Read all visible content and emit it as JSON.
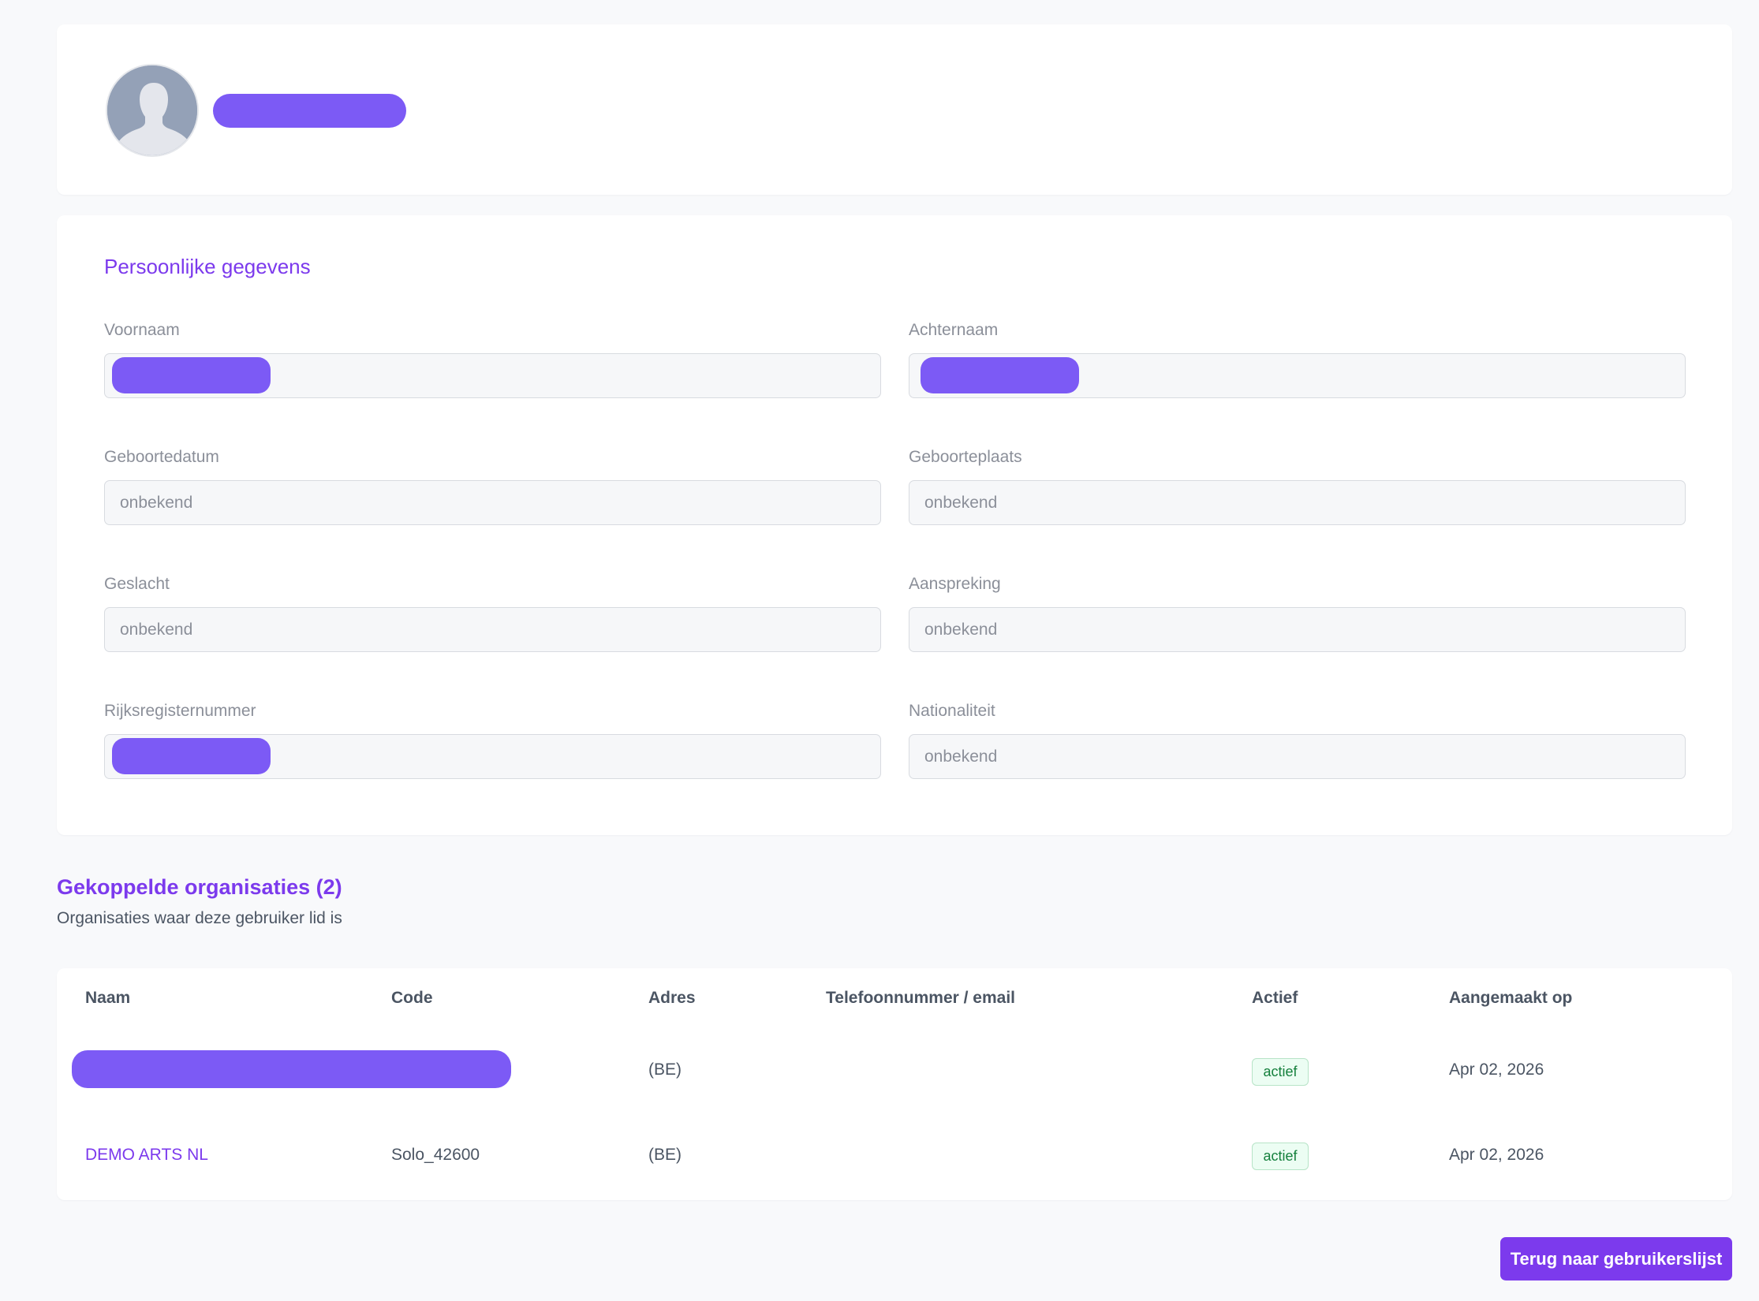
{
  "profile": {
    "avatar_icon": "user-silhouette-icon"
  },
  "personal": {
    "title": "Persoonlijke gegevens",
    "fields": [
      {
        "label": "Voornaam",
        "value": ""
      },
      {
        "label": "Achternaam",
        "value": ""
      },
      {
        "label": "Geboortedatum",
        "value": "onbekend"
      },
      {
        "label": "Geboorteplaats",
        "value": "onbekend"
      },
      {
        "label": "Geslacht",
        "value": "onbekend"
      },
      {
        "label": "Aanspreking",
        "value": "onbekend"
      },
      {
        "label": "Rijksregisternummer",
        "value": ""
      },
      {
        "label": "Nationaliteit",
        "value": "onbekend"
      }
    ]
  },
  "organisations": {
    "title": "Gekoppelde organisaties (2)",
    "subtitle": "Organisaties waar deze gebruiker lid is",
    "columns": [
      "Naam",
      "Code",
      "Adres",
      "Telefoonnummer / email",
      "Actief",
      "Aangemaakt op"
    ],
    "rows": [
      {
        "name": "",
        "code": "",
        "address": "(BE)",
        "contact": "",
        "active": "actief",
        "created": "Apr 02, 2026"
      },
      {
        "name": "DEMO ARTS NL",
        "code": "Solo_42600",
        "address": "(BE)",
        "contact": "",
        "active": "actief",
        "created": "Apr 02, 2026"
      }
    ]
  },
  "actions": {
    "back_label": "Terug naar gebruikerslijst"
  },
  "colors": {
    "accent": "#7c3aed",
    "redaction": "#7c5af5",
    "badge_text": "#15803d",
    "badge_bg": "#ecfdf3"
  }
}
